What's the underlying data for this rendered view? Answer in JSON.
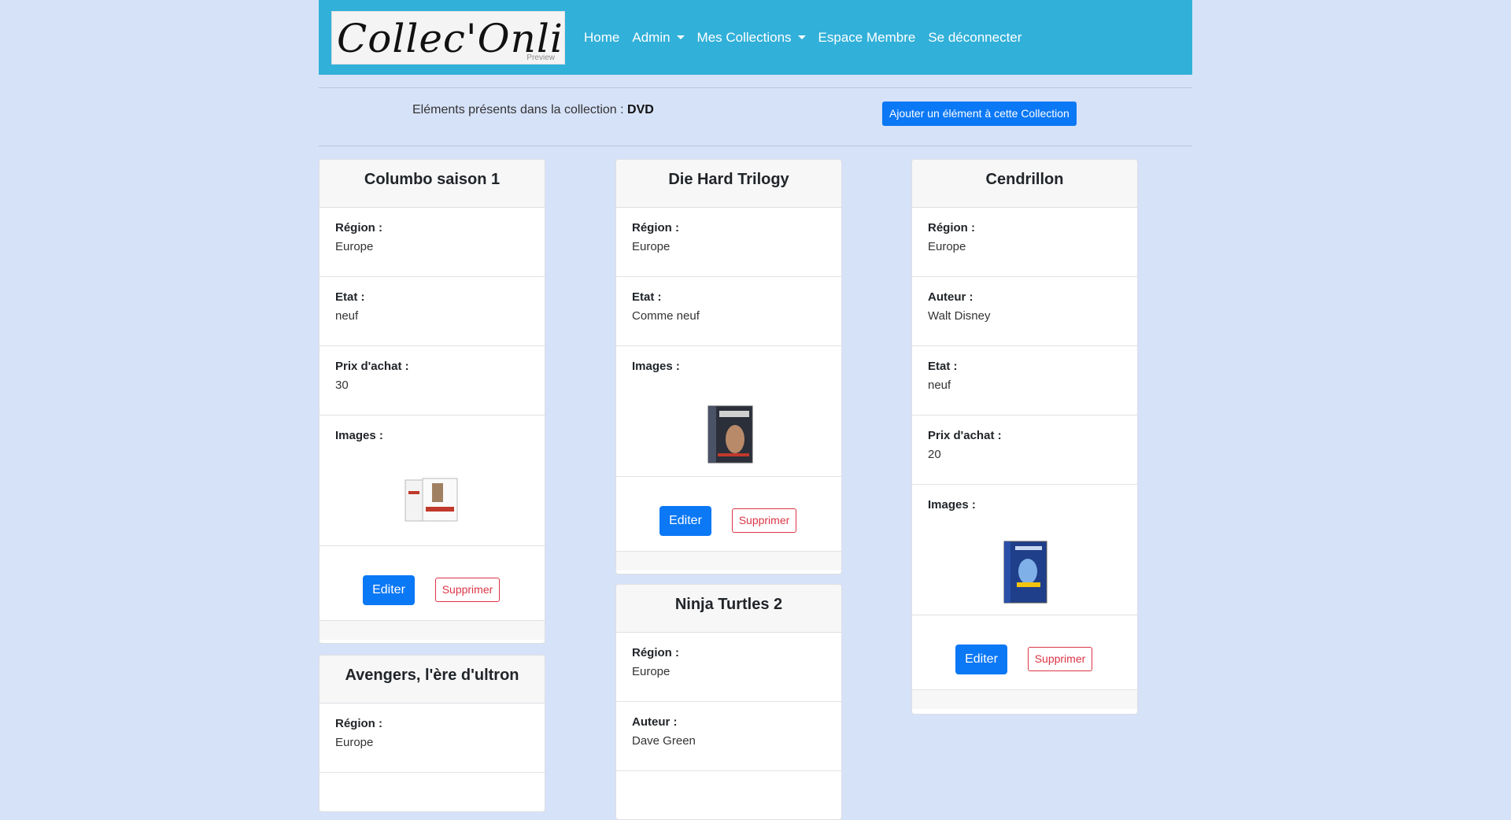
{
  "brand": {
    "name": "Collec'Online",
    "tag": "Preview"
  },
  "nav": {
    "home": "Home",
    "admin": "Admin",
    "collections": "Mes Collections",
    "member": "Espace Membre",
    "logout": "Se déconnecter"
  },
  "subheader": {
    "text": "Eléments présents dans la collection : ",
    "collection": "DVD",
    "add_button": "Ajouter un élément à cette Collection"
  },
  "labels": {
    "region": "Région :",
    "etat": "Etat :",
    "prix": "Prix d'achat :",
    "images": "Images :",
    "auteur": "Auteur :",
    "edit": "Editer",
    "delete": "Supprimer"
  },
  "cards": [
    {
      "title": "Columbo saison 1",
      "region": "Europe",
      "etat": "neuf",
      "prix": "30"
    },
    {
      "title": "Die Hard Trilogy",
      "region": "Europe",
      "etat": "Comme neuf"
    },
    {
      "title": "Cendrillon",
      "region": "Europe",
      "auteur": "Walt Disney",
      "etat": "neuf",
      "prix": "20"
    },
    {
      "title": "Avengers, l'ère d'ultron",
      "region": "Europe"
    },
    {
      "title": "Ninja Turtles 2",
      "region": "Europe",
      "auteur": "Dave Green"
    }
  ]
}
